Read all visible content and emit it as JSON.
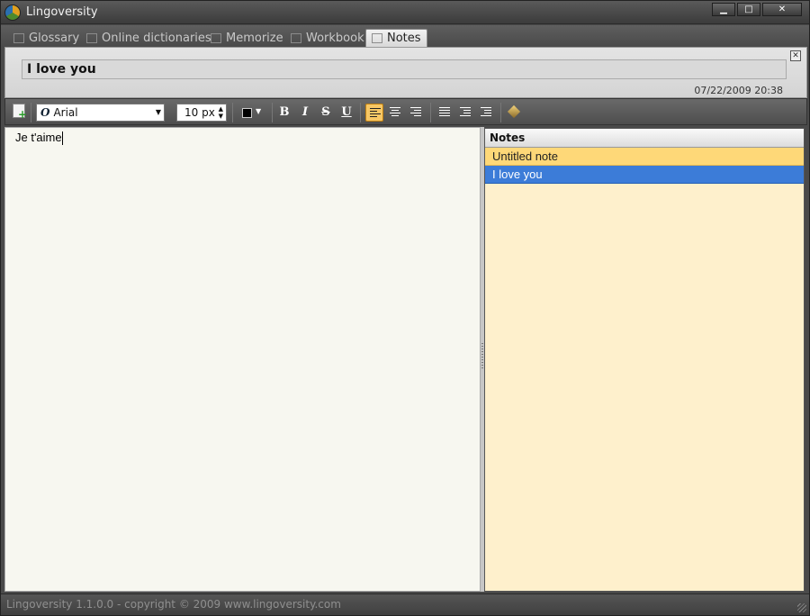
{
  "window": {
    "title": "Lingoversity",
    "buttons": {
      "minimize": "▁",
      "maximize": "□",
      "close": "✕"
    }
  },
  "tabs": [
    {
      "label": "Glossary",
      "icon": "list-icon",
      "active": false
    },
    {
      "label": "Online dictionaries",
      "icon": "books-icon",
      "active": false
    },
    {
      "label": "Memorize",
      "icon": "checkbox-icon",
      "active": false
    },
    {
      "label": "Workbook",
      "icon": "workbook-icon",
      "active": false
    },
    {
      "label": "Notes",
      "icon": "note-icon",
      "active": true
    }
  ],
  "note": {
    "title": "I love you",
    "date": "07/22/2009 20:38",
    "close_label": "✕"
  },
  "toolbar": {
    "font": "Arial",
    "font_icon": "O",
    "font_caret": "▼",
    "size": "10 px",
    "color": "#000000",
    "color_caret": "▼",
    "bold": "B",
    "italic": "I",
    "strike": "S",
    "underline": "U",
    "alignment": "left"
  },
  "editor": {
    "content": "Je t'aime"
  },
  "notes_list": {
    "header": "Notes",
    "items": [
      {
        "label": "Untitled note",
        "state": "highlight"
      },
      {
        "label": "I love you",
        "state": "selected"
      }
    ]
  },
  "status": {
    "text": "Lingoversity 1.1.0.0   -   copyright © 2009 www.lingoversity.com"
  },
  "colors": {
    "accent": "#3c7cd8",
    "list_bg": "#fef0cc",
    "highlight": "#fed878",
    "align_active": "#f7c765"
  }
}
